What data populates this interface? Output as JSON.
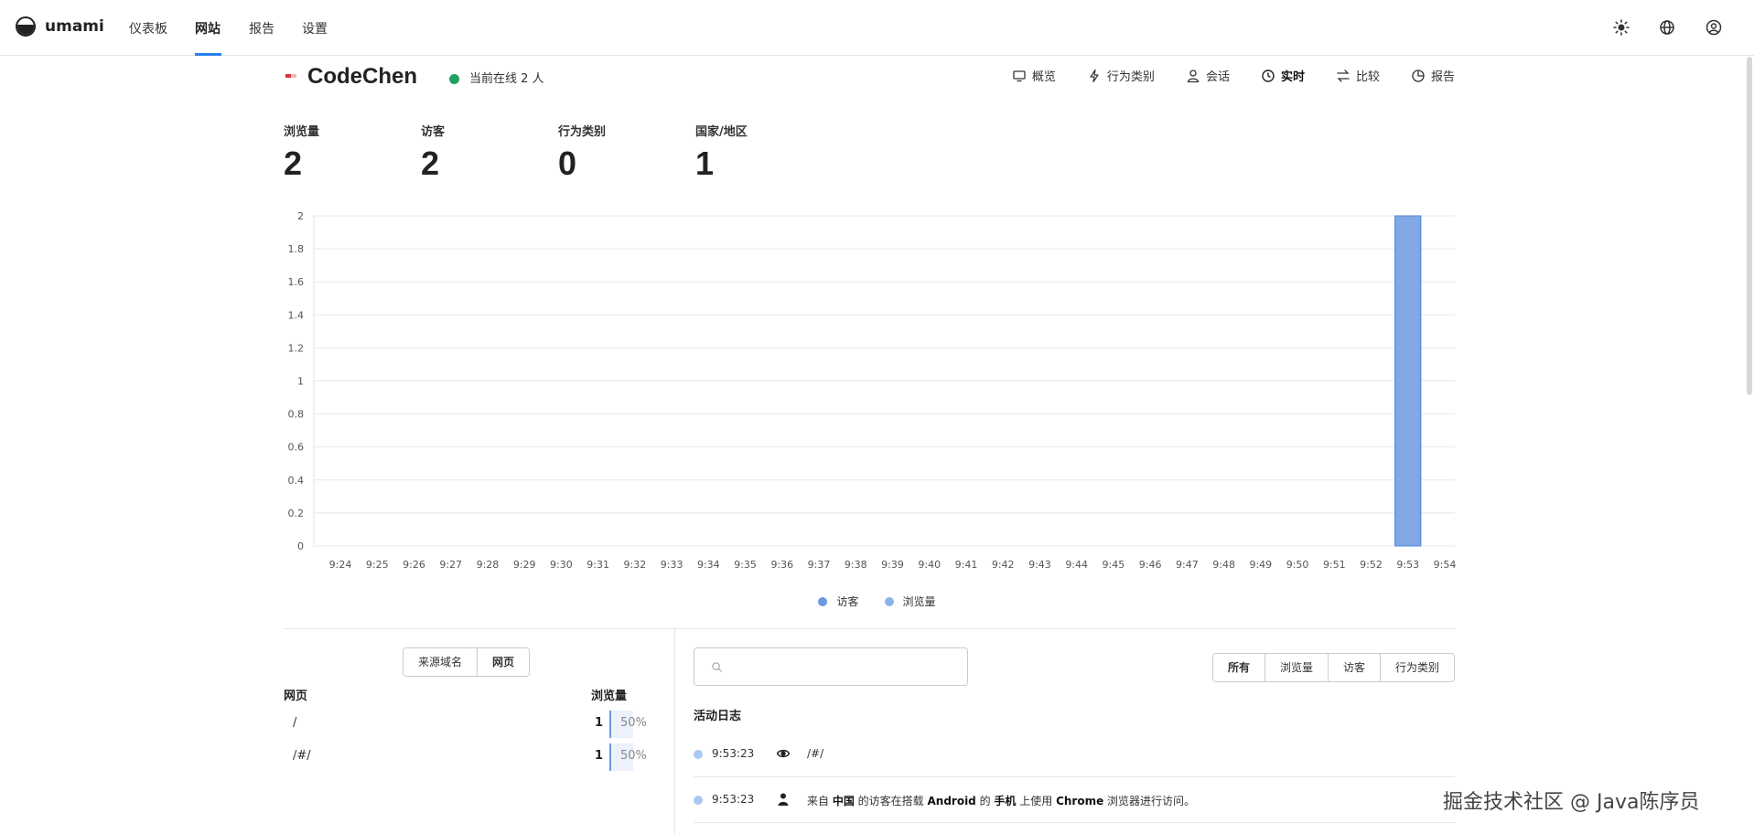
{
  "nav": {
    "brand": "umami",
    "items": [
      {
        "label": "仪表板"
      },
      {
        "label": "网站"
      },
      {
        "label": "报告"
      },
      {
        "label": "设置"
      }
    ],
    "active_index": 1,
    "right_icons": [
      "sun-icon",
      "globe-icon",
      "user-icon"
    ]
  },
  "site": {
    "name": "CodeChen",
    "online_text": "当前在线 2 人",
    "favicon_colors": [
      "#d9333f",
      "#f5b8bc"
    ]
  },
  "site_tabs": [
    {
      "label": "概览",
      "icon": "monitor-icon"
    },
    {
      "label": "行为类别",
      "icon": "bolt-icon"
    },
    {
      "label": "会话",
      "icon": "user-icon"
    },
    {
      "label": "实时",
      "icon": "clock-icon",
      "active": true
    },
    {
      "label": "比较",
      "icon": "swap-icon"
    },
    {
      "label": "报告",
      "icon": "report-icon"
    }
  ],
  "metrics": [
    {
      "label": "浏览量",
      "value": "2"
    },
    {
      "label": "访客",
      "value": "2"
    },
    {
      "label": "行为类别",
      "value": "0"
    },
    {
      "label": "国家/地区",
      "value": "1"
    }
  ],
  "chart_data": {
    "type": "bar",
    "categories": [
      "9:24",
      "9:25",
      "9:26",
      "9:27",
      "9:28",
      "9:29",
      "9:30",
      "9:31",
      "9:32",
      "9:33",
      "9:34",
      "9:35",
      "9:36",
      "9:37",
      "9:38",
      "9:39",
      "9:40",
      "9:41",
      "9:42",
      "9:43",
      "9:44",
      "9:45",
      "9:46",
      "9:47",
      "9:48",
      "9:49",
      "9:50",
      "9:51",
      "9:52",
      "9:53",
      "9:54"
    ],
    "series": [
      {
        "name": "访客",
        "color": "#6a9ae0",
        "values": [
          0,
          0,
          0,
          0,
          0,
          0,
          0,
          0,
          0,
          0,
          0,
          0,
          0,
          0,
          0,
          0,
          0,
          0,
          0,
          0,
          0,
          0,
          0,
          0,
          0,
          0,
          0,
          0,
          0,
          2,
          0
        ]
      },
      {
        "name": "浏览量",
        "color": "#8fb2e8",
        "values": [
          0,
          0,
          0,
          0,
          0,
          0,
          0,
          0,
          0,
          0,
          0,
          0,
          0,
          0,
          0,
          0,
          0,
          0,
          0,
          0,
          0,
          0,
          0,
          0,
          0,
          0,
          0,
          0,
          0,
          2,
          0
        ]
      }
    ],
    "ylim": [
      0,
      2
    ],
    "yticks": [
      "0",
      "0.2",
      "0.4",
      "0.6",
      "0.8",
      "1",
      "1.2",
      "1.4",
      "1.6",
      "1.8",
      "2"
    ],
    "grid": true,
    "legend_position": "bottom"
  },
  "left_panel": {
    "segments": [
      "来源域名",
      "网页"
    ],
    "active_segment": 1,
    "col_page": "网页",
    "col_views": "浏览量",
    "rows": [
      {
        "path": "/",
        "count": "1",
        "pct": "50%",
        "share": 0.5
      },
      {
        "path": "/#/",
        "count": "1",
        "pct": "50%",
        "share": 0.5
      }
    ]
  },
  "right_panel": {
    "search_placeholder": "",
    "filters": [
      "所有",
      "浏览量",
      "访客",
      "行为类别"
    ],
    "active_filter": 0,
    "title": "活动日志",
    "log": [
      {
        "time": "9:53:23",
        "icon": "eye-icon",
        "parts": [
          {
            "t": "/#/",
            "b": false
          }
        ]
      },
      {
        "time": "9:53:23",
        "icon": "person-icon",
        "parts": [
          {
            "t": "来自 ",
            "b": false
          },
          {
            "t": "中国",
            "b": true
          },
          {
            "t": " 的访客在搭载 ",
            "b": false
          },
          {
            "t": "Android",
            "b": true
          },
          {
            "t": " 的 ",
            "b": false
          },
          {
            "t": "手机",
            "b": true
          },
          {
            "t": " 上使用 ",
            "b": false
          },
          {
            "t": "Chrome",
            "b": true
          },
          {
            "t": " 浏览器进行访问。",
            "b": false
          }
        ]
      }
    ]
  },
  "watermark": "掘金技术社区 @ Java陈序员"
}
